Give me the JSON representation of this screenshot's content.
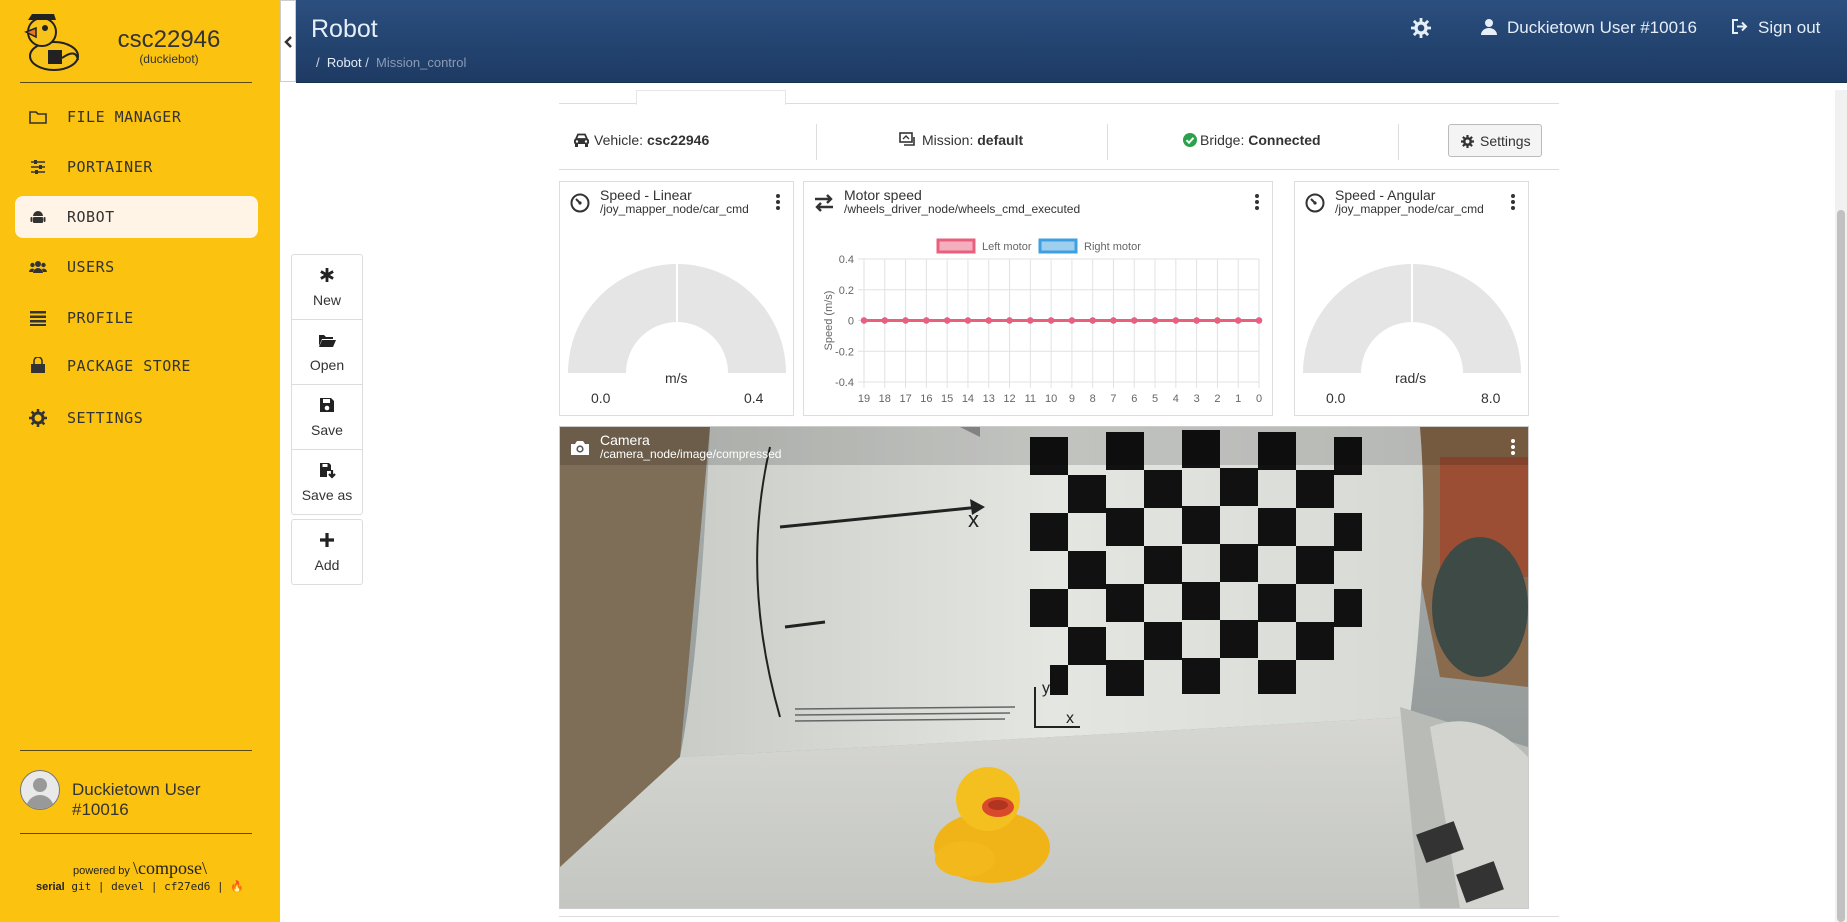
{
  "sidebar": {
    "title": "csc22946",
    "subtitle": "(duckiebot)",
    "items": [
      {
        "label": "FILE MANAGER",
        "icon": "folder-icon"
      },
      {
        "label": "PORTAINER",
        "icon": "sliders-icon"
      },
      {
        "label": "ROBOT",
        "icon": "android-icon",
        "active": true
      },
      {
        "label": "USERS",
        "icon": "users-icon"
      },
      {
        "label": "PROFILE",
        "icon": "list-icon"
      },
      {
        "label": "PACKAGE STORE",
        "icon": "shopping-bag-icon"
      },
      {
        "label": "SETTINGS",
        "icon": "gear-icon"
      }
    ],
    "user": "Duckietown User #10016",
    "powered_by": "powered by",
    "compose": "\\compose\\",
    "serial_label": "serial",
    "serial_info": "git | devel | cf27ed6 |"
  },
  "header": {
    "title": "Robot",
    "breadcrumb_root": "/",
    "breadcrumb_robot": "Robot",
    "breadcrumb_sep": "/",
    "breadcrumb_current": "Mission_control",
    "user": "Duckietown User #10016",
    "signout": "Sign out"
  },
  "toolbar": {
    "new": "New",
    "open": "Open",
    "save": "Save",
    "save_as": "Save as",
    "add": "Add"
  },
  "status": {
    "vehicle_label": "Vehicle:",
    "vehicle_value": "csc22946",
    "mission_label": "Mission:",
    "mission_value": "default",
    "bridge_label": "Bridge:",
    "bridge_value": "Connected",
    "settings": "Settings"
  },
  "panels": {
    "linear": {
      "title": "Speed - Linear",
      "topic": "/joy_mapper_node/car_cmd",
      "unit": "m/s",
      "min": "0.0",
      "max": "0.4"
    },
    "motor": {
      "title": "Motor speed",
      "topic": "/wheels_driver_node/wheels_cmd_executed"
    },
    "angular": {
      "title": "Speed - Angular",
      "topic": "/joy_mapper_node/car_cmd",
      "unit": "rad/s",
      "min": "0.0",
      "max": "8.0"
    },
    "camera": {
      "title": "Camera",
      "topic": "/camera_node/image/compressed"
    }
  },
  "chart_data": {
    "type": "line",
    "title": "",
    "xlabel": "",
    "ylabel": "Speed (m/s)",
    "ylim": [
      -0.4,
      0.4
    ],
    "y_ticks": [
      "0.4",
      "0.2",
      "0",
      "-0.2",
      "-0.4"
    ],
    "categories": [
      "19",
      "18",
      "17",
      "16",
      "15",
      "14",
      "13",
      "12",
      "11",
      "10",
      "9",
      "8",
      "7",
      "6",
      "5",
      "4",
      "3",
      "2",
      "1",
      "0"
    ],
    "series": [
      {
        "name": "Left motor",
        "color": "#e8607e",
        "values": [
          0,
          0,
          0,
          0,
          0,
          0,
          0,
          0,
          0,
          0,
          0,
          0,
          0,
          0,
          0,
          0,
          0,
          0,
          0,
          0
        ]
      },
      {
        "name": "Right motor",
        "color": "#3ea0e0",
        "values": [
          0,
          0,
          0,
          0,
          0,
          0,
          0,
          0,
          0,
          0,
          0,
          0,
          0,
          0,
          0,
          0,
          0,
          0,
          0,
          0
        ]
      }
    ],
    "grid": true,
    "legend": "top-center"
  }
}
